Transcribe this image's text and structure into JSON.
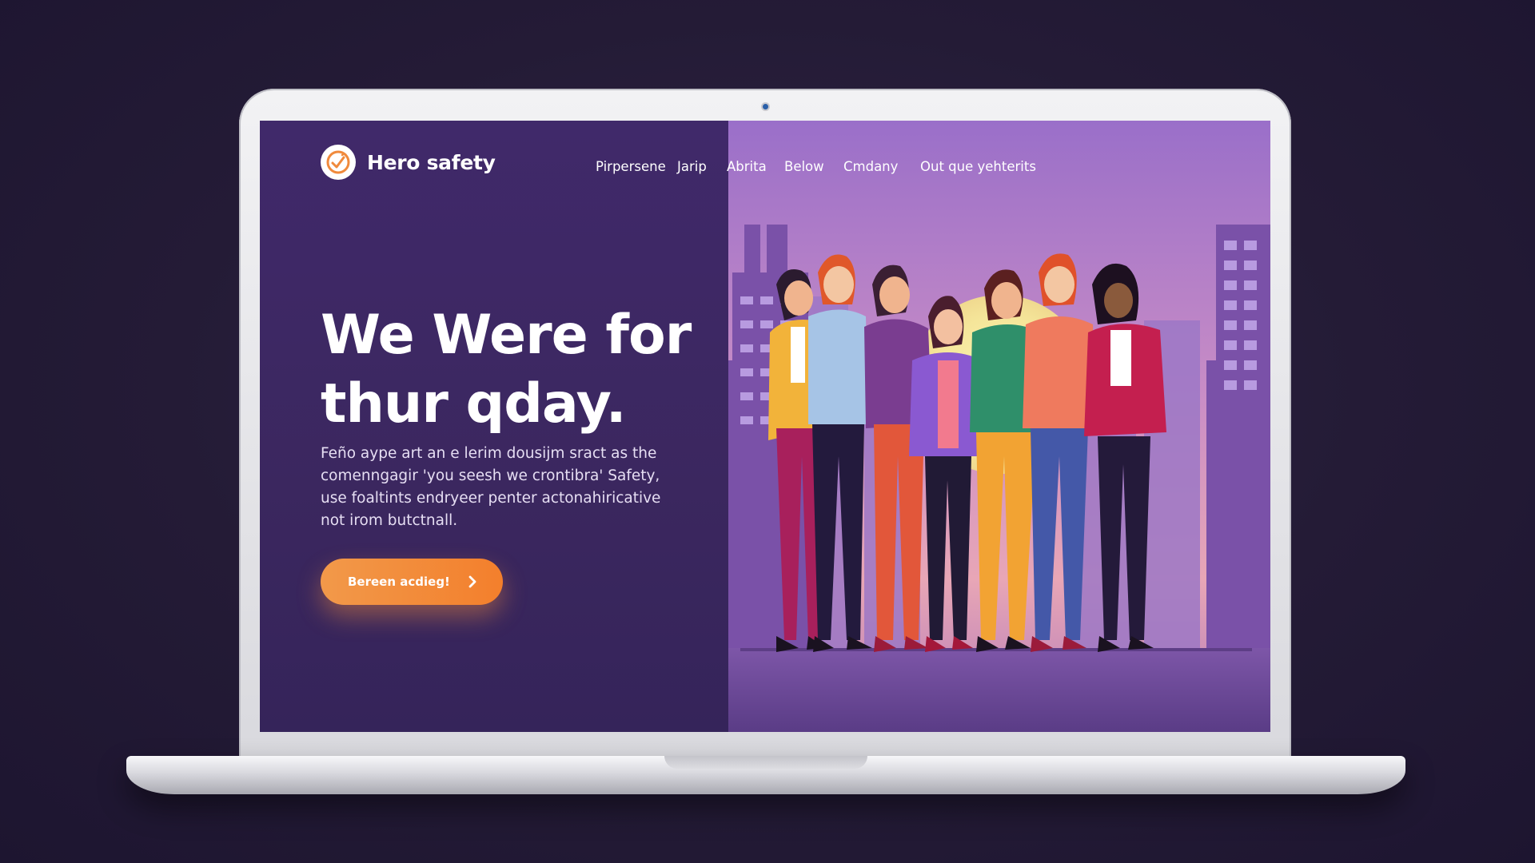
{
  "brand": {
    "name": "Hero safety",
    "logo_icon": "flame-check-logo-icon",
    "logo_color": "#f08a3c"
  },
  "nav": {
    "items": [
      {
        "label": "Pirpersene"
      },
      {
        "label": "Jarip"
      },
      {
        "label": "Abrita"
      },
      {
        "label": "Below"
      },
      {
        "label": "Cmdany"
      },
      {
        "label": "Out que yehterits"
      }
    ]
  },
  "hero": {
    "headline_line1": "We Were for",
    "headline_line2": "thur qday.",
    "description": "Feño aype art an e lerim dousijm sract as the comenngagir 'you seesh we crontibra' Safety, use foaltints endryeer penter actonahiricative not irom butctnall.",
    "cta_label": "Bereen acdieg!",
    "cta_icon": "chevron-right-icon"
  },
  "colors": {
    "background": "#241b36",
    "left_panel": "#3d2a63",
    "accent": "#f2994a",
    "sky_top": "#a77ad0",
    "sky_bottom": "#e59fb4",
    "sun": "#f6eba0"
  },
  "illustration": {
    "subject": "group of seven women standing in front of a city skyline at sunset"
  }
}
